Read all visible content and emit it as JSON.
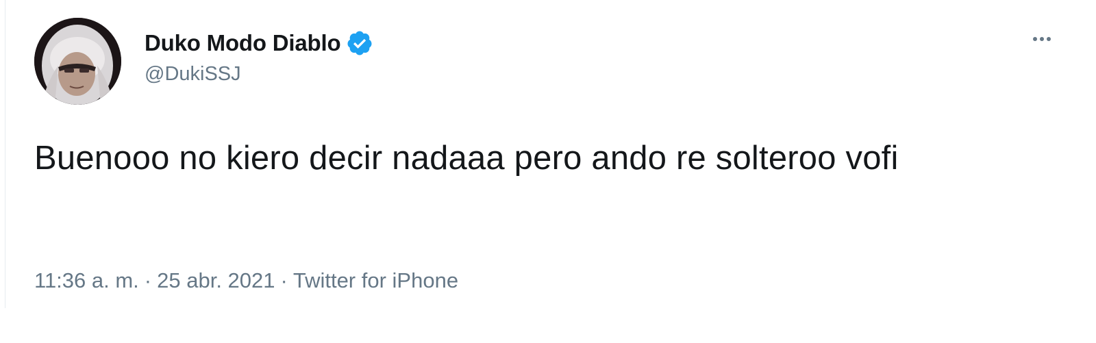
{
  "tweet": {
    "author": {
      "display_name": "Duko Modo Diablo",
      "handle": "@DukiSSJ",
      "verified": true,
      "avatar_icon": "profile-photo"
    },
    "menu_icon": "more-icon",
    "text": "Buenooo no kiero decir nadaaa pero ando re solteroo vofi",
    "meta": {
      "time": "11:36 a. m.",
      "separator": "·",
      "date": "25 abr. 2021",
      "source": "Twitter for iPhone"
    }
  },
  "colors": {
    "text_primary": "#14171a",
    "text_secondary": "#657786",
    "verified_blue": "#1da1f2",
    "background": "#ffffff"
  }
}
